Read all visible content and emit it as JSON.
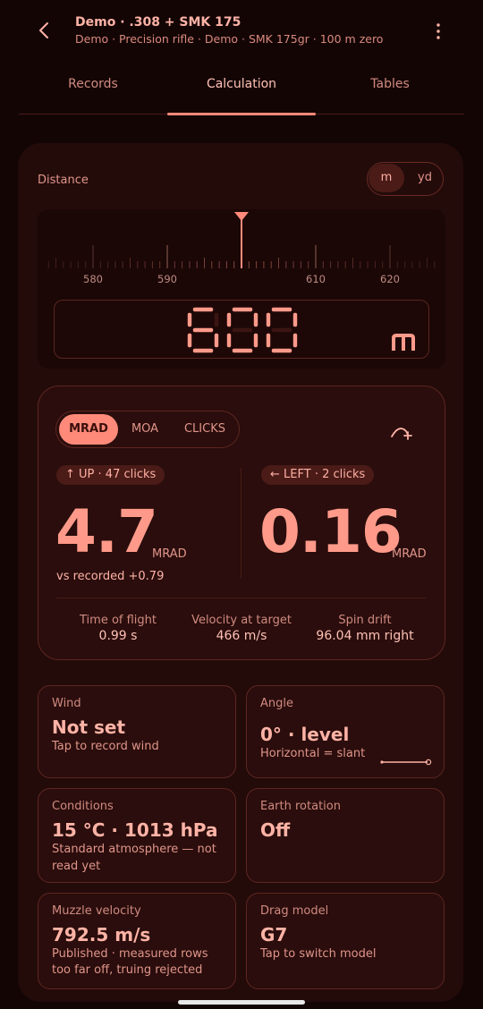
{
  "header": {
    "title": "Demo · .308 + SMK 175",
    "subtitle": "Demo · Precision rifle · Demo · SMK 175gr · 100 m zero"
  },
  "tabs": [
    "Records",
    "Calculation",
    "Tables"
  ],
  "active_tab": "Calculation",
  "distance": {
    "label": "Distance",
    "units": [
      "m",
      "yd"
    ],
    "selected_unit": "m",
    "ruler_labels": [
      "580",
      "590",
      "610",
      "620"
    ],
    "value": "600",
    "unit_display": "m"
  },
  "calc": {
    "modes": [
      "MRAD",
      "MOA",
      "CLICKS"
    ],
    "selected_mode": "MRAD",
    "elevation": {
      "chip": "UP · 47 clicks",
      "value": "4.7",
      "unit": "MRAD",
      "note": "vs recorded +0.79"
    },
    "windage": {
      "chip": "LEFT · 2 clicks",
      "value": "0.16",
      "unit": "MRAD"
    },
    "stats": [
      {
        "label": "Time of flight",
        "value": "0.99 s"
      },
      {
        "label": "Velocity at target",
        "value": "466 m/s"
      },
      {
        "label": "Spin drift",
        "value": "96.04 mm right"
      }
    ]
  },
  "tiles": {
    "wind": {
      "title": "Wind",
      "value": "Not set",
      "desc": "Tap to record wind"
    },
    "angle": {
      "title": "Angle",
      "value": "0° · level",
      "desc": "Horizontal = slant"
    },
    "conditions": {
      "title": "Conditions",
      "value": "15 °C · 1013 hPa",
      "desc1": "Standard atmosphere — not",
      "desc2": "read yet"
    },
    "earth": {
      "title": "Earth rotation",
      "value": "Off"
    },
    "muzzle": {
      "title": "Muzzle velocity",
      "value": "792.5 m/s",
      "desc1": "Published · measured rows",
      "desc2": "too far off, truing rejected"
    },
    "drag": {
      "title": "Drag model",
      "value": "G7",
      "desc": "Tap to switch model"
    }
  },
  "colors": {
    "accent": "#ff8a7a",
    "background": "#140505",
    "card": "#230b0a"
  }
}
